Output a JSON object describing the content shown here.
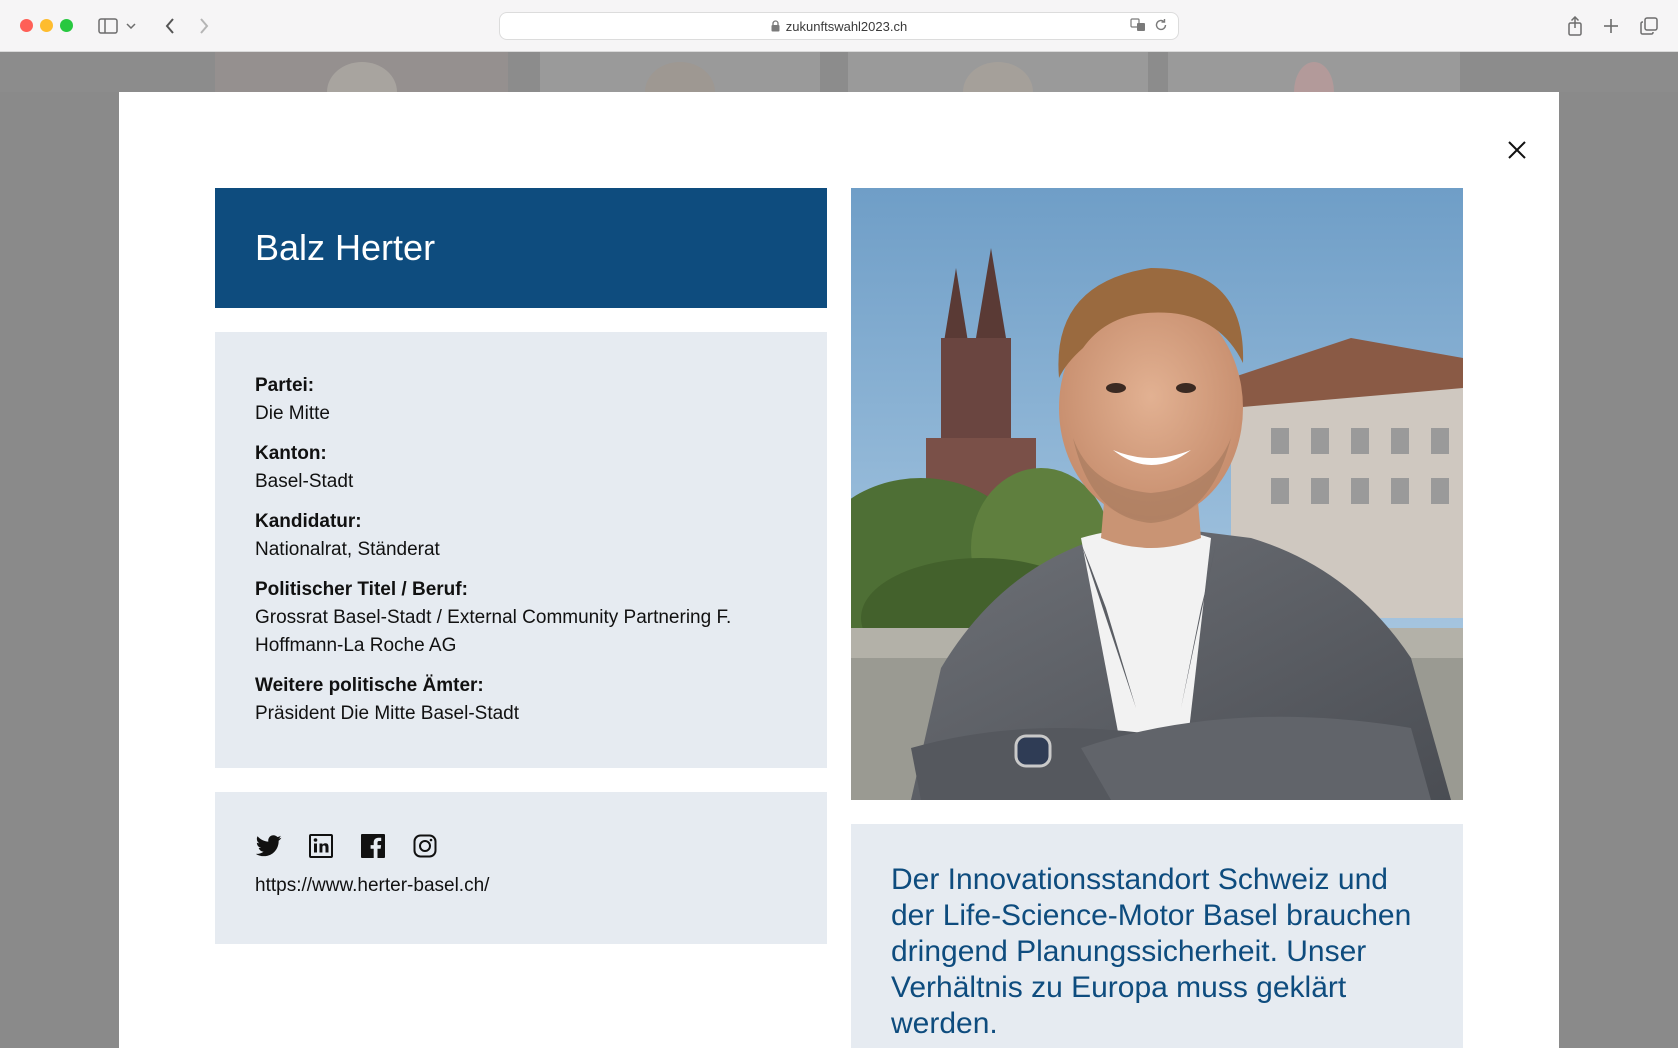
{
  "browser": {
    "url": "zukunftswahl2023.ch"
  },
  "modal": {
    "name": "Balz Herter",
    "info": [
      {
        "label": "Partei:",
        "value": "Die Mitte"
      },
      {
        "label": "Kanton:",
        "value": "Basel-Stadt"
      },
      {
        "label": "Kandidatur:",
        "value": "Nationalrat, Ständerat"
      },
      {
        "label": "Politischer Titel / Beruf:",
        "value": "Grossrat Basel-Stadt / External Community Partnering F. Hoffmann-La Roche AG"
      },
      {
        "label": "Weitere politische Ämter:",
        "value": "Präsident Die Mitte Basel-Stadt"
      }
    ],
    "social": {
      "icons": [
        "twitter-icon",
        "linkedin-icon",
        "facebook-icon",
        "instagram-icon"
      ],
      "website": "https://www.herter-basel.ch/"
    },
    "quote": "Der Innovationsstandort Schweiz und der Life-Science-Motor Basel brauchen dringend Planungssicherheit. Unser Verhältnis zu Europa muss geklärt werden.",
    "colors": {
      "accent": "#0e4c7e",
      "panel": "#e6ebf1"
    }
  }
}
